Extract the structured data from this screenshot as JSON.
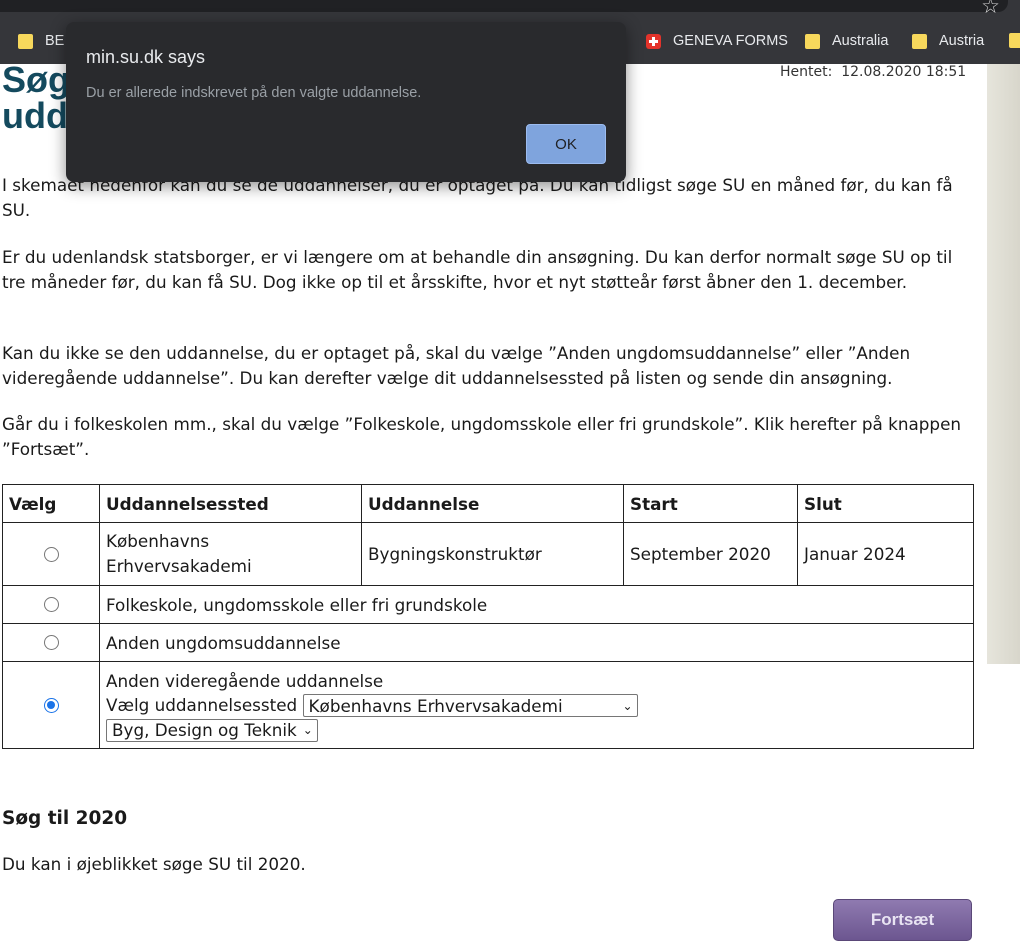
{
  "browser": {
    "bookmarks": [
      {
        "label": "BE",
        "icon": "folder-icon"
      },
      {
        "label": "GENEVA FORMS",
        "icon": "swiss-flag-icon"
      },
      {
        "label": "Australia",
        "icon": "folder-icon"
      },
      {
        "label": "Austria",
        "icon": "folder-icon"
      }
    ],
    "star_icon": "star-icon"
  },
  "page": {
    "title": "Søg til uddannelse",
    "hentet": "Hentet:  12.08.2020 18:51",
    "paragraphs": [
      "I skemaet nedenfor kan du se de uddannelser, du er optaget på. Du kan tidligst søge SU en måned før, du kan få SU.",
      "Er du udenlandsk statsborger, er vi længere om at behandle din ansøgning. Du kan derfor normalt søge SU op til tre måneder før, du kan få SU. Dog ikke op til et årsskifte, hvor et nyt støtteår først åbner den 1. december.",
      "Kan du ikke se den uddannelse, du er optaget på, skal du vælge ”Anden ungdomsuddannelse” eller ”Anden videregående uddannelse”. Du kan derefter vælge dit uddannelsessted på listen og sende din ansøgning.",
      "Går du i folkeskolen mm., skal du vælge ”Folkeskole, ungdomsskole eller fri grundskole”. Klik herefter på knappen ”Fortsæt”."
    ],
    "table": {
      "headers": [
        "Vælg",
        "Uddannelsessted",
        "Uddannelse",
        "Start",
        "Slut"
      ],
      "row1": {
        "sted_line1": "Københavns",
        "sted_line2": "Erhvervsakademi",
        "uddannelse": "Bygningskonstruktør",
        "start": "September 2020",
        "slut": "Januar 2024"
      },
      "row2": "Folkeskole, ungdomsskole eller fri grundskole",
      "row3": "Anden ungdomsuddannelse",
      "row4": {
        "label": "Anden videregående uddannelse",
        "select_label": "Vælg uddannelsessted",
        "select1_value": "Københavns Erhvervsakademi",
        "select2_value": "Byg, Design og Teknik"
      },
      "selected_row": 4
    },
    "soeg_title": "Søg til 2020",
    "soeg_text": "Du kan i øjeblikket søge SU til  2020.",
    "continue_button": "Fortsæt"
  },
  "dialog": {
    "title": "min.su.dk says",
    "message": "Du er allerede indskrevet på den valgte uddannelse.",
    "ok_label": "OK"
  },
  "colors": {
    "title": "#144a5e",
    "button_purple": "#7a64a0",
    "dialog_bg": "#292a2d",
    "ok_button": "#7fa4dd"
  }
}
